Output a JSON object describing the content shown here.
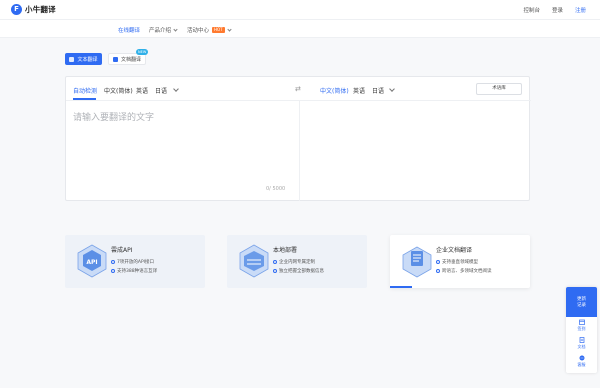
{
  "app": {
    "logo_letter": "F",
    "name": "小牛翻译"
  },
  "topbar": {
    "console": "控制台",
    "login": "登录",
    "register": "注册"
  },
  "subnav": {
    "items": [
      "在线翻译",
      "产品介绍",
      "活动中心"
    ],
    "hot_badge": "HOT"
  },
  "modes": {
    "text": "文本翻译",
    "doc": "文档翻译",
    "new_badge": "NEW"
  },
  "translator": {
    "source_langs": [
      "自动检测",
      "中文(简体)",
      "英语",
      "日语"
    ],
    "target_langs": [
      "中文(简体)",
      "英语",
      "日语"
    ],
    "swap_icon": "⇄",
    "glossary": "术语库",
    "placeholder": "请输入要翻译的文字",
    "counter": "0/ 5000"
  },
  "cards": [
    {
      "title": "雲成API",
      "features": [
        "7项开放的API接口",
        "支持388种语言互译"
      ]
    },
    {
      "title": "本地部署",
      "features": [
        "企业内网专属定制",
        "独立把握全部数据信息"
      ]
    },
    {
      "title": "企业文档翻译",
      "features": [
        "支持垂直领域模型",
        "跨语言、多领域文档阅读"
      ],
      "progress": 0.16
    }
  ],
  "sidebar": {
    "top": "更新\n记录",
    "items": [
      "签到",
      "文档",
      "客服"
    ]
  },
  "colors": {
    "accent": "#2f6bf2",
    "hot": "#ff7a2f",
    "new": "#2fb0e8"
  }
}
